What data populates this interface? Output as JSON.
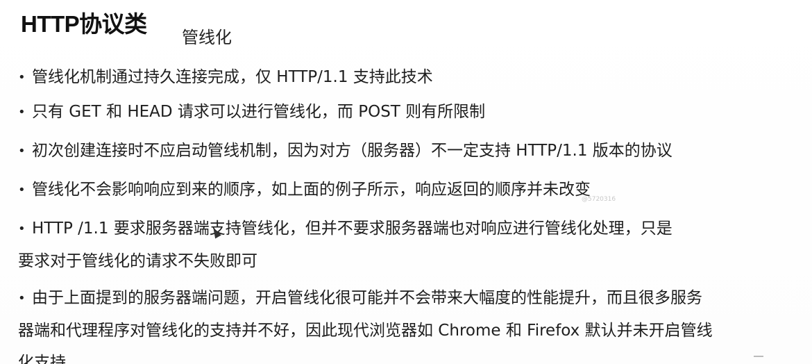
{
  "slide": {
    "title": "HTTP协议类",
    "subtitle": "管线化",
    "bullet_symbol": "•",
    "bullets": [
      {
        "lines": [
          "管线化机制通过持久连接完成，仅 HTTP/1.1 支持此技术"
        ]
      },
      {
        "lines": [
          "只有 GET 和 HEAD 请求可以进行管线化，而 POST 则有所限制"
        ]
      },
      {
        "lines": [
          "初次创建连接时不应启动管线机制，因为对方（服务器）不一定支持 HTTP/1.1 版本的协议"
        ]
      },
      {
        "lines": [
          "管线化不会影响响应到来的顺序，如上面的例子所示，响应返回的顺序并未改变"
        ]
      },
      {
        "lines": [
          "HTTP /1.1 要求服务器端支持管线化，但并不要求服务器端也对响应进行管线化处理，只是",
          "要求对于管线化的请求不失败即可"
        ]
      },
      {
        "lines": [
          "由于上面提到的服务器端问题，开启管线化很可能并不会带来大幅度的性能提升，而且很多服务",
          "器端和代理程序对管线化的支持并不好，因此现代浏览器如 Chrome 和 Firefox 默认并未开启管线",
          "化支持"
        ]
      }
    ],
    "watermark": "@5720316"
  }
}
